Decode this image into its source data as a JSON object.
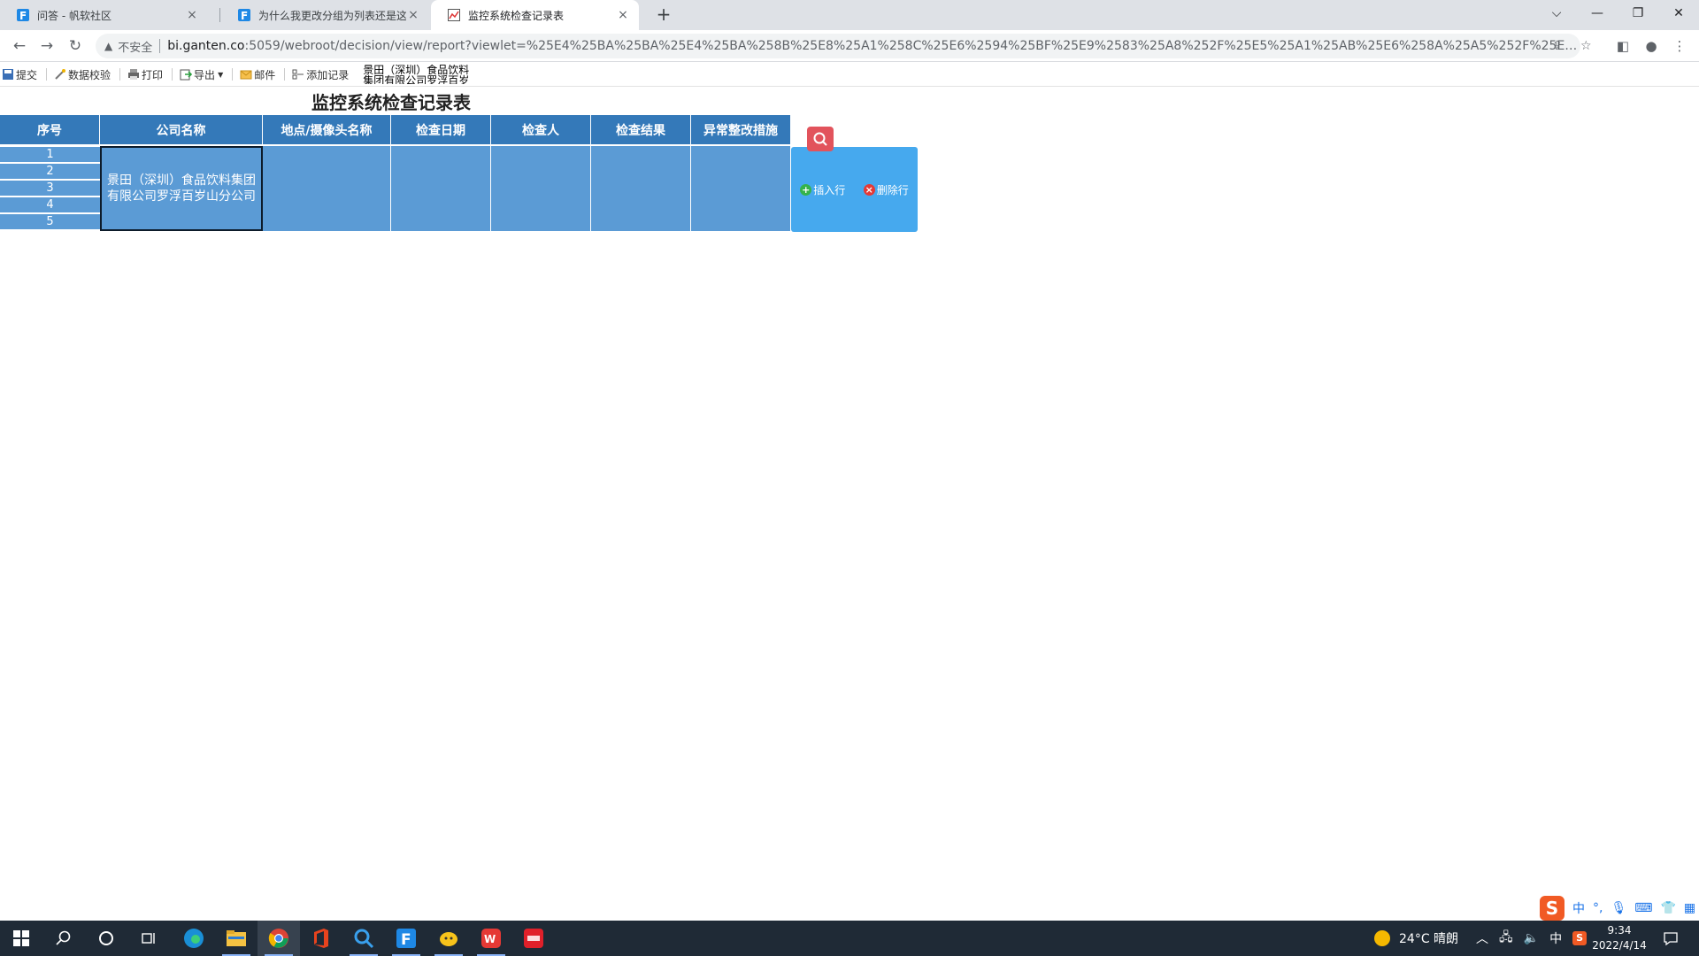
{
  "browser": {
    "tabs": [
      {
        "title": "问答 - 帆软社区",
        "close": "×"
      },
      {
        "title": "为什么我更改分组为列表还是这样",
        "close": "×"
      },
      {
        "title": "监控系统检查记录表",
        "close": "×"
      }
    ],
    "new_tab": "+",
    "insecure_label": "不安全",
    "url_host": "bi.ganten.co",
    "url_path": ":5059/webroot/decision/view/report?viewlet=%25E4%25BA%25BA%25E4%25BA%258B%25E8%25A1%258C%25E6%2594%25BF%25E9%2583%25A8%252F%25E5%25A1%25AB%25E6%258A%25A5%252F%25E7%259..."
  },
  "report_toolbar": {
    "submit": "提交",
    "validate": "数据校验",
    "print": "打印",
    "export": "导出",
    "mail": "邮件",
    "add_record": "添加记录",
    "company_tip": "景田（深圳）食品饮料集团有限公司罗浮百岁"
  },
  "report": {
    "title": "监控系统检查记录表",
    "headers": [
      "序号",
      "公司名称",
      "地点/摄像头名称",
      "检查日期",
      "检查人",
      "检查结果",
      "异常整改措施"
    ],
    "row_numbers": [
      "1",
      "2",
      "3",
      "4",
      "5"
    ],
    "company": "景田（深圳）食品饮料集团有限公司罗浮百岁山分公司",
    "insert_row": "插入行",
    "delete_row": "删除行"
  },
  "ime": {
    "lang": "中",
    "punct": "°,"
  },
  "taskbar": {
    "weather": "24°C  晴朗",
    "ime_lang": "中",
    "time": "9:34",
    "date": "2022/4/14"
  },
  "colors": {
    "header_blue": "#3479b9",
    "cell_blue": "#5b9bd5",
    "action_blue": "#46a9ee",
    "search_red": "#e2535c"
  }
}
